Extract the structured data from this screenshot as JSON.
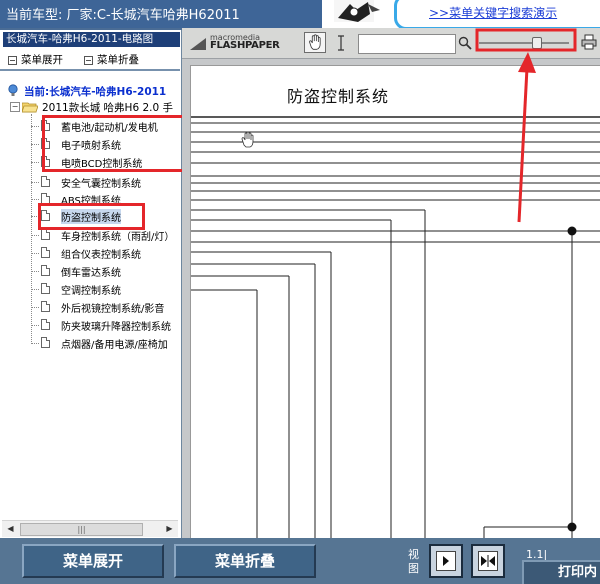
{
  "header": {
    "car_model": "当前车型:  厂家:C-长城汽车哈弗H62011",
    "banner_link": ">>菜单关键字搜索演示"
  },
  "sidebar": {
    "title": "长城汽车-哈弗H6-2011-电路图",
    "expand_all": "菜单展开",
    "collapse_all": "菜单折叠",
    "current_label": "当前:长城汽车-哈弗H6-2011",
    "folder_label": "2011款长城 哈弗H6 2.0 手",
    "items": [
      {
        "label": "蓄电池/起动机/发电机"
      },
      {
        "label": "电子喷射系统"
      },
      {
        "label": "电喷BCD控制系统"
      },
      {
        "label": "安全气囊控制系统"
      },
      {
        "label": "ABS控制系统"
      },
      {
        "label": "防盗控制系统"
      },
      {
        "label": "车身控制系统（雨刮/灯）"
      },
      {
        "label": "组合仪表控制系统"
      },
      {
        "label": "倒车雷达系统"
      },
      {
        "label": "空调控制系统"
      },
      {
        "label": "外后视镜控制系统/影音"
      },
      {
        "label": "防夹玻璃升降器控制系统"
      },
      {
        "label": "点烟器/备用电源/座椅加"
      }
    ],
    "selected_item": "防盗控制系统"
  },
  "viewer": {
    "logo_small": "macromedia",
    "logo_big": "FLASHPAPER",
    "page_input": "",
    "document_title": "防盗控制系统"
  },
  "footer": {
    "expand_button": "菜单展开",
    "collapse_button": "菜单折叠",
    "view_label": "视图",
    "page_count": "1.1|",
    "print_label": "打印内"
  },
  "colors": {
    "annotation_red": "#e4262a",
    "header_blue": "#3e6597",
    "tree_title_bg": "#1e3f78"
  }
}
